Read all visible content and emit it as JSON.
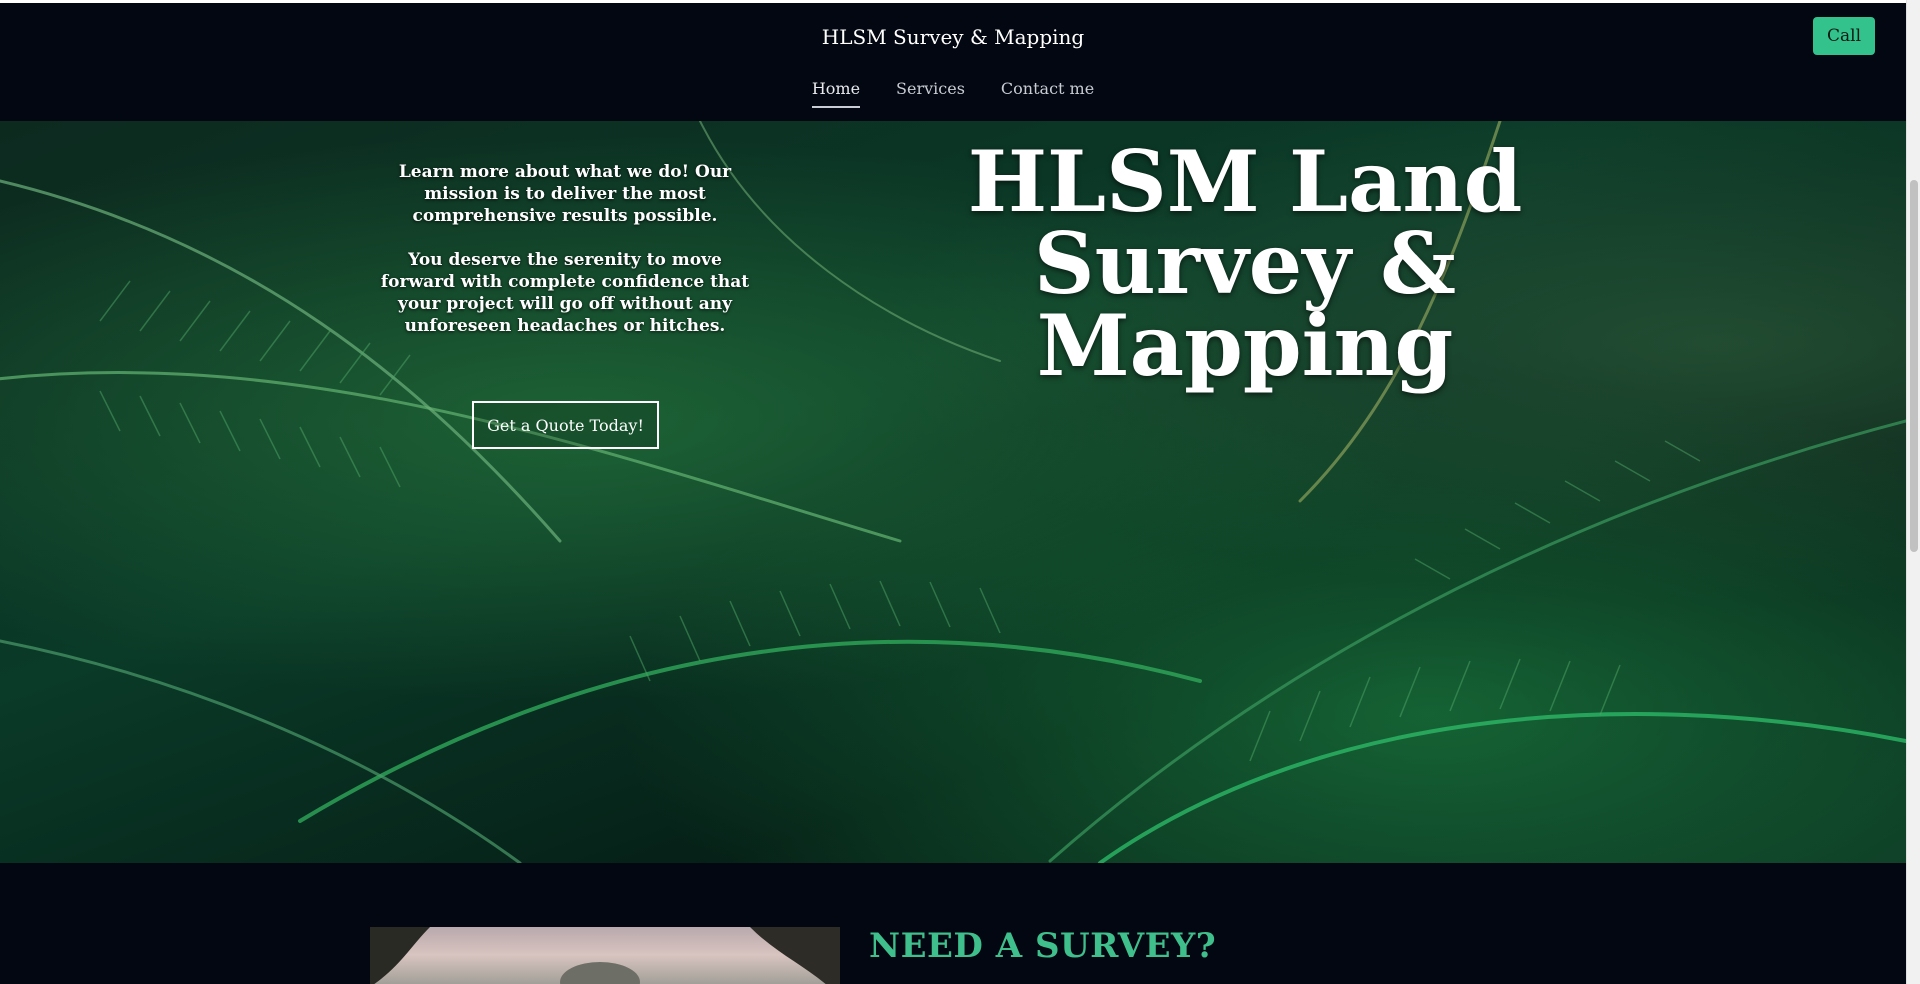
{
  "header": {
    "site_title": "HLSM Survey & Mapping",
    "call_label": "Call",
    "nav": [
      {
        "label": "Home",
        "active": true
      },
      {
        "label": "Services",
        "active": false
      },
      {
        "label": "Contact me",
        "active": false
      }
    ]
  },
  "hero": {
    "paragraph_1": "Learn more about what we do! Our mission is to deliver the most comprehensive results possible.",
    "paragraph_2": "You deserve the serenity to move forward with complete confidence that your project will go off without any unforeseen headaches or hitches.",
    "cta_label": "Get a Quote Today!",
    "heading": "HLSM Land Survey & Mapping",
    "background_icon": "palm-leaves-photo"
  },
  "about": {
    "heading": "NEED A SURVEY?",
    "photo_icon": "trees-photo"
  },
  "colors": {
    "background": "#030711",
    "accent": "#34c28c",
    "heading_accent": "#3fbf8c"
  }
}
